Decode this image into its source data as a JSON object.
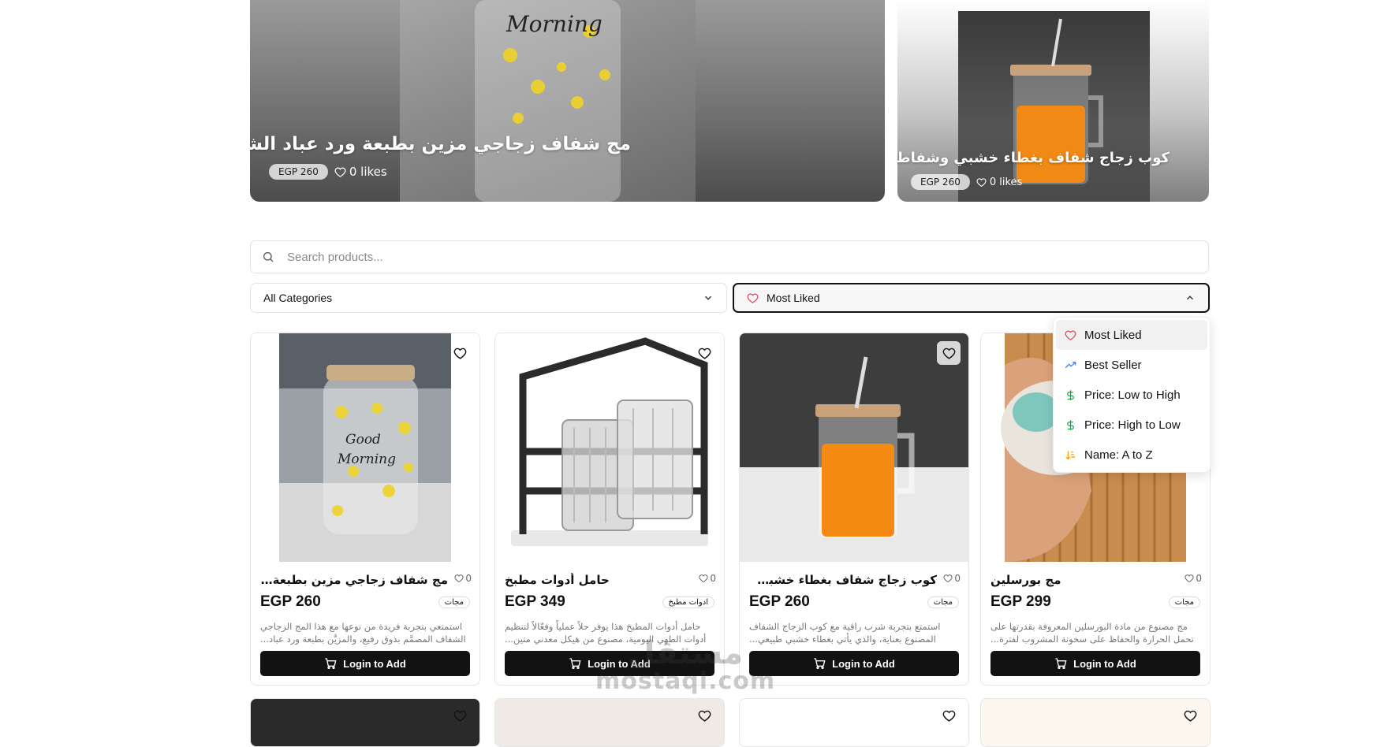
{
  "hero": {
    "main": {
      "title": "مج شفاف زجاجي مزين بطبعة ورد عباد الشمس",
      "price": "EGP 260",
      "likes": "0 likes"
    },
    "side": {
      "title": "كوب زجاج شفاف بغطاء خشبي وشفاطة زجاج",
      "price": "EGP 260",
      "likes": "0 likes"
    }
  },
  "search": {
    "placeholder": "Search products..."
  },
  "filters": {
    "category": "All Categories",
    "sort": "Most Liked",
    "sort_options": [
      "Most Liked",
      "Best Seller",
      "Price: Low to High",
      "Price: High to Low",
      "Name: A to Z"
    ]
  },
  "products": [
    {
      "title": "مج شفاف زجاجي مزين بطبعة ورد...",
      "likes": "0",
      "price": "EGP 260",
      "category": "مجات",
      "description": "استمتعي بتجربة فريدة من نوعها مع هذا المج الزجاجي الشفاف المصمَّم بذوق رفيع، والمزيَّن بطبعة ورد عباد...",
      "button": "Login to Add"
    },
    {
      "title": "حامل أدوات مطبخ",
      "likes": "0",
      "price": "EGP 349",
      "category": "ادوات مطبخ",
      "description": "حامل أدوات المطبخ هذا يوفر حلاً عملياً وفعّالاً لتنظيم أدوات الطهي اليومية، مصنوع من هيكل معدني متين...",
      "button": "Login to Add"
    },
    {
      "title": "كوب زجاج شفاف بغطاء خشبي...",
      "likes": "0",
      "price": "EGP 260",
      "category": "مجات",
      "description": "استمتع بتجربة شرب راقية مع كوب الزجاج الشفاف المصنوع بعناية، والذي يأتي بغطاء خشبي طبيعي...",
      "button": "Login to Add"
    },
    {
      "title": "مج بورسلين",
      "likes": "0",
      "price": "EGP 299",
      "category": "مجات",
      "description": "مج مصنوع من مادة البورسلين المعروفة بقدرتها على تحمل الحرارة والحفاظ على سخونة المشروب لفترة...",
      "button": "Login to Add"
    }
  ],
  "watermark": {
    "arabic": "مستقل",
    "latin": "mostaql.com"
  },
  "colors": {
    "accent_heart": "#e0455a",
    "trend": "#3b82f6",
    "price_icon": "#16a34a",
    "sort_az": "#f59e0b",
    "button": "#121212"
  }
}
